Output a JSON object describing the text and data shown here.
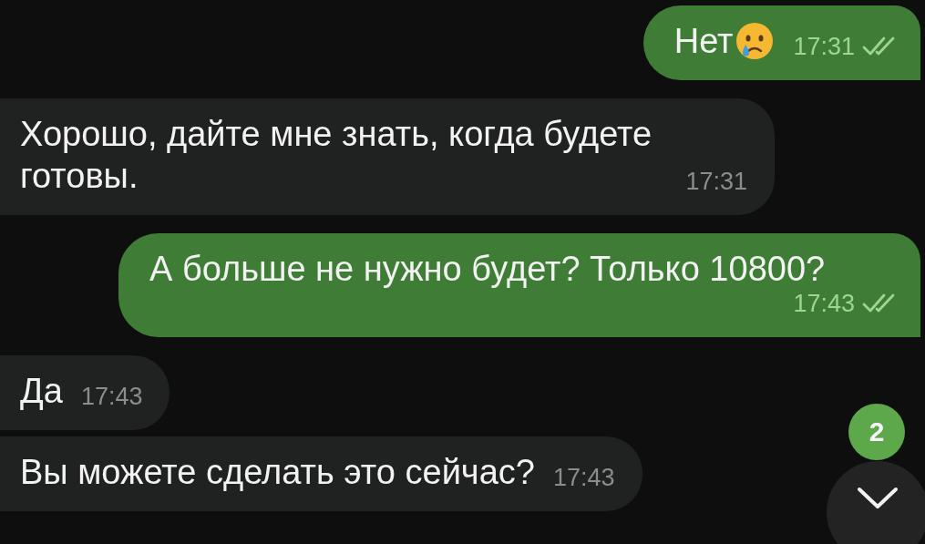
{
  "messages": [
    {
      "kind": "outgoing",
      "text": "Нет",
      "trailing_emoji": true,
      "time": "17:31",
      "read": true
    },
    {
      "kind": "incoming",
      "text": "Хорошо, дайте мне знать, когда будете готовы.",
      "time": "17:31"
    },
    {
      "kind": "outgoing",
      "text": "А больше не нужно будет? Только 10800?",
      "time": "17:43",
      "read": true
    },
    {
      "kind": "incoming",
      "text": "Да",
      "time": "17:43"
    },
    {
      "kind": "incoming",
      "text": "Вы можете сделать это сейчас?",
      "time": "17:43"
    }
  ],
  "scroll_down": {
    "unread_badge": "2"
  }
}
